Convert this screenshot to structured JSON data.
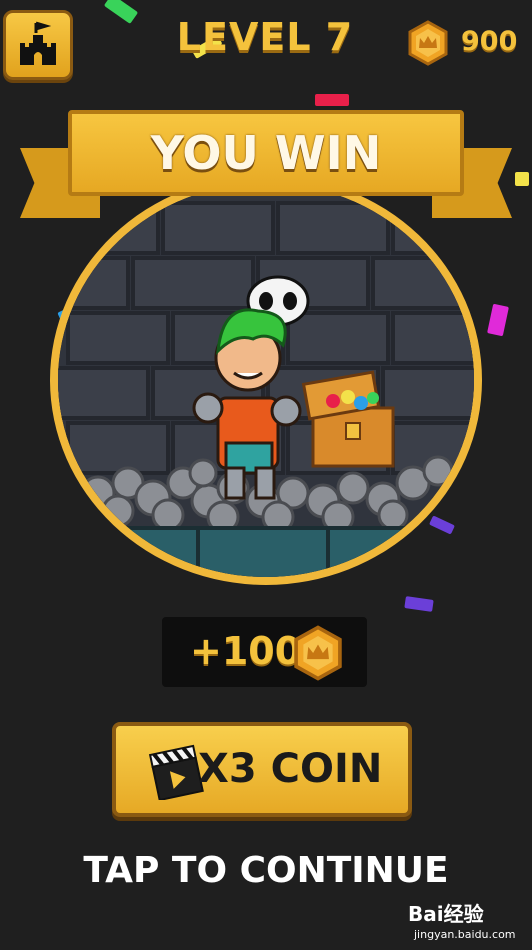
{
  "header": {
    "home_icon": "castle-icon",
    "level_label": "LEVEL 7",
    "coin_icon": "crown-coin-icon",
    "coin_total": "900"
  },
  "banner": {
    "title": "YOU WIN"
  },
  "scene": {
    "hero": "green-haired-knight",
    "chest": "treasure-chest",
    "ghost": "skull-ghost"
  },
  "reward": {
    "amount": "+100",
    "icon": "crown-coin-icon"
  },
  "multiply_button": {
    "icon": "clapperboard-icon",
    "label": "X3 COIN"
  },
  "continue_text": "TAP TO CONTINUE",
  "watermark": {
    "brand": "Bai经验",
    "url": "jingyan.baidu.com"
  },
  "colors": {
    "background": "#1f1f1f",
    "gold": "#f4c23c",
    "frame": "#f0b83a"
  }
}
